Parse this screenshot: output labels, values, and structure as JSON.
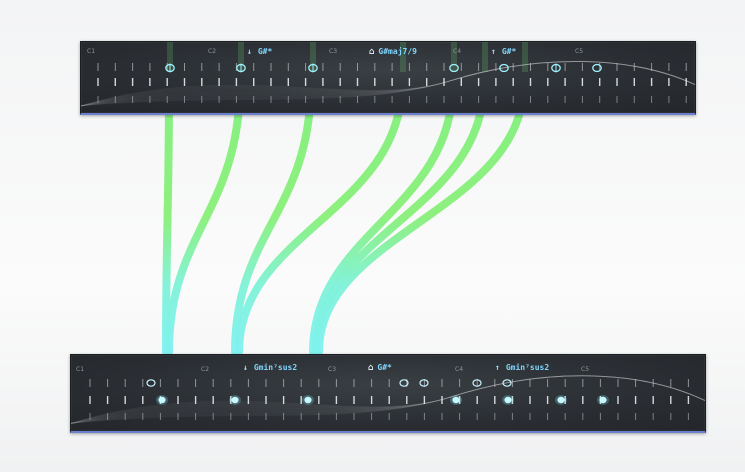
{
  "top_staff": {
    "octaves": [
      "C1",
      "C2",
      "C3",
      "C4",
      "C5"
    ],
    "chords": [
      {
        "icon": "down-arrow-icon",
        "glyph": "↓",
        "label": "G#*"
      },
      {
        "icon": "home-icon",
        "glyph": "⌂",
        "label": "G#maj7/9"
      },
      {
        "icon": "up-arrow-icon",
        "glyph": "↑",
        "label": "G#*"
      }
    ]
  },
  "bottom_staff": {
    "octaves": [
      "C1",
      "C2",
      "C3",
      "C4",
      "C5"
    ],
    "chords": [
      {
        "icon": "down-arrow-icon",
        "glyph": "↓",
        "label": "Gmin⁷sus2"
      },
      {
        "icon": "home-icon",
        "glyph": "⌂",
        "label": "G#*"
      },
      {
        "icon": "up-arrow-icon",
        "glyph": "↑",
        "label": "Gmin⁷sus2"
      }
    ]
  },
  "colors": {
    "voice_green": "#7ff07a",
    "voice_cyan": "#7ff2f0",
    "note_cyan": "#9ff3ff",
    "accent_blue": "#6b7fd0"
  }
}
